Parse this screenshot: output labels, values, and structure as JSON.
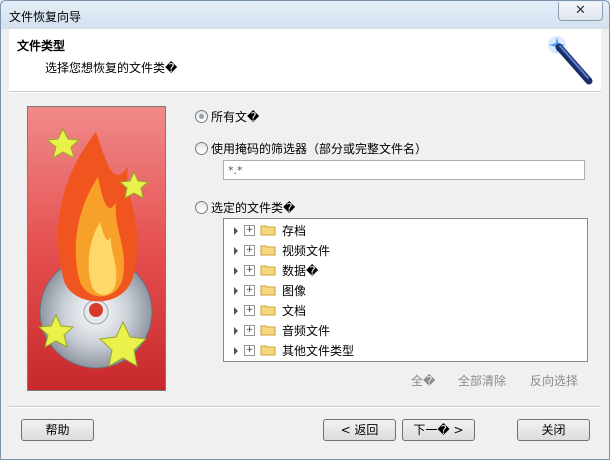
{
  "window": {
    "title": "文件恢复向导",
    "close_glyph": "✕"
  },
  "header": {
    "title": "文件类型",
    "subtitle": "选择您想恢复的文件类�"
  },
  "options": {
    "all_files": "所有文�",
    "mask_filter": "使用掩码的筛选器（部分或完整文件名）",
    "mask_value": "*.*",
    "selected_types": "选定的文件类�"
  },
  "tree": {
    "items": [
      {
        "label": "存档"
      },
      {
        "label": "视频文件"
      },
      {
        "label": "数据�"
      },
      {
        "label": "图像"
      },
      {
        "label": "文档"
      },
      {
        "label": "音频文件"
      },
      {
        "label": "其他文件类型"
      }
    ]
  },
  "selection_links": {
    "all": "全�",
    "clear_all": "全部清除",
    "invert": "反向选择"
  },
  "buttons": {
    "help": "帮助",
    "back": "< 返回",
    "next": "下一� >",
    "close": "关闭"
  },
  "colors": {
    "art_background": "#e85a5a",
    "flame": "#f39a1e",
    "star": "#e6f04a"
  }
}
